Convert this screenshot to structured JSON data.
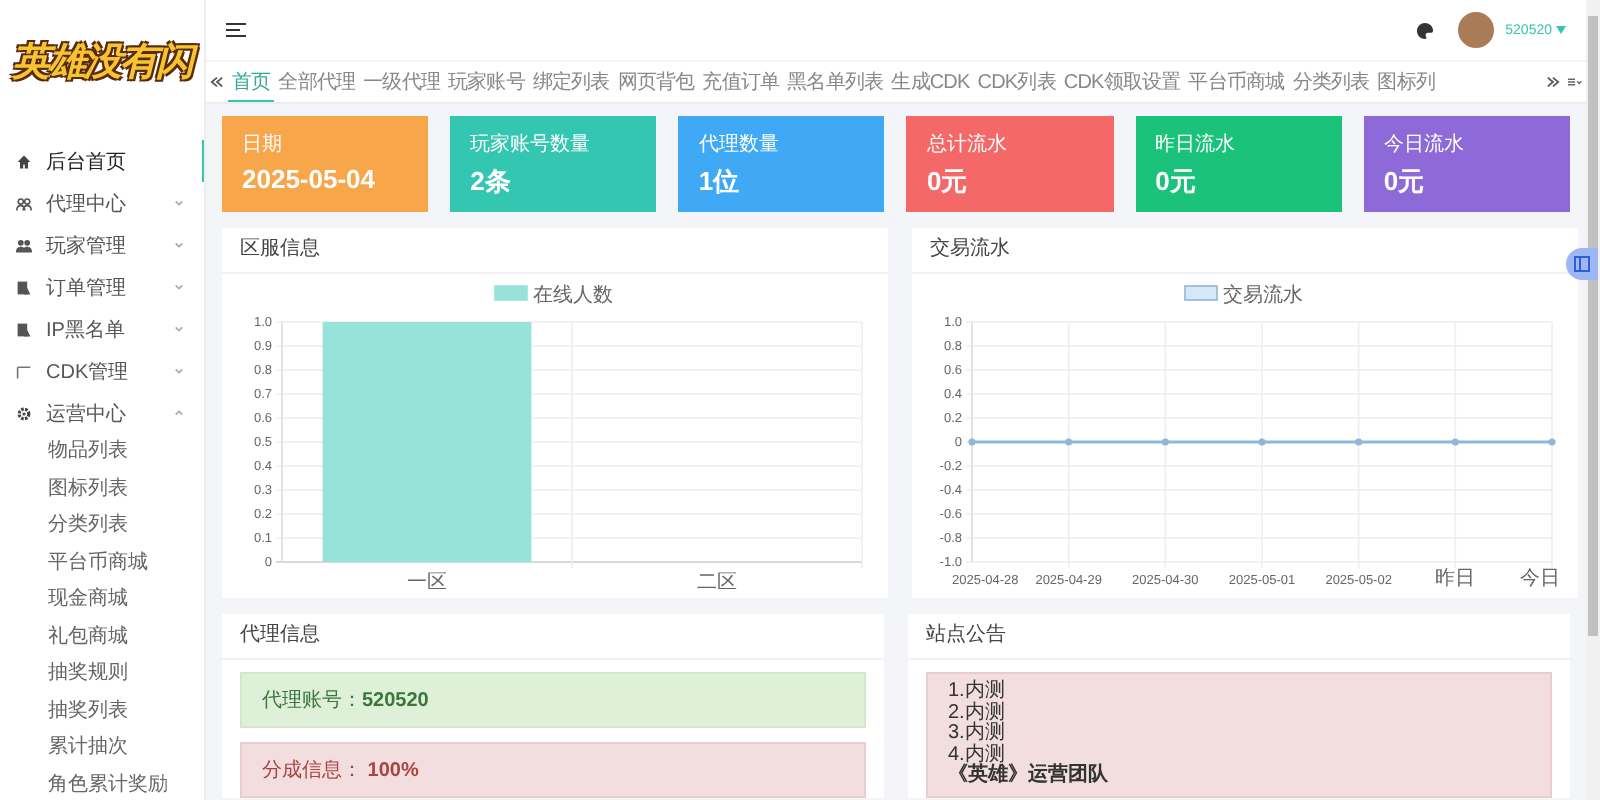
{
  "logo": {
    "text": "英雄没有闪"
  },
  "sidebar": {
    "items": [
      {
        "label": "后台首页",
        "kind": "link",
        "selected": true
      },
      {
        "label": "代理中心",
        "kind": "group",
        "selected": false,
        "expanded": false
      },
      {
        "label": "玩家管理",
        "kind": "group",
        "selected": false,
        "expanded": false
      },
      {
        "label": "订单管理",
        "kind": "group",
        "selected": false,
        "expanded": false
      },
      {
        "label": "IP黑名单",
        "kind": "group",
        "selected": false,
        "expanded": false
      },
      {
        "label": "CDK管理",
        "kind": "group",
        "selected": false,
        "expanded": false
      },
      {
        "label": "运营中心",
        "kind": "group",
        "selected": false,
        "expanded": true,
        "children": [
          {
            "label": "物品列表"
          },
          {
            "label": "图标列表"
          },
          {
            "label": "分类列表"
          },
          {
            "label": "平台币商城"
          },
          {
            "label": "现金商城"
          },
          {
            "label": "礼包商城"
          },
          {
            "label": "抽奖规则"
          },
          {
            "label": "抽奖列表"
          },
          {
            "label": "累计抽次"
          },
          {
            "label": "角色累计奖励"
          }
        ]
      }
    ]
  },
  "header": {
    "user": "520520"
  },
  "tabs": [
    {
      "label": "首页",
      "selected": true
    },
    {
      "label": "全部代理",
      "selected": false
    },
    {
      "label": "一级代理",
      "selected": false
    },
    {
      "label": "玩家账号",
      "selected": false
    },
    {
      "label": "绑定列表",
      "selected": false
    },
    {
      "label": "网页背包",
      "selected": false
    },
    {
      "label": "充值订单",
      "selected": false
    },
    {
      "label": "黑名单列表",
      "selected": false
    },
    {
      "label": "生成CDK",
      "selected": false
    },
    {
      "label": "CDK列表",
      "selected": false
    },
    {
      "label": "CDK领取设置",
      "selected": false
    },
    {
      "label": "平台币商城",
      "selected": false
    },
    {
      "label": "分类列表",
      "selected": false
    },
    {
      "label": "图标列",
      "selected": false
    }
  ],
  "stats": [
    {
      "title": "日期",
      "value": "2025-05-04",
      "color": "#f8a64a"
    },
    {
      "title": "玩家账号数量",
      "value": "2条",
      "color": "#33c6b0"
    },
    {
      "title": "代理数量",
      "value": "1位",
      "color": "#3fa9f5"
    },
    {
      "title": "总计流水",
      "value": "0元",
      "color": "#f56868"
    },
    {
      "title": "昨日流水",
      "value": "0元",
      "color": "#1bc27a"
    },
    {
      "title": "今日流水",
      "value": "0元",
      "color": "#8e6ad8"
    }
  ],
  "server_panel": {
    "title": "区服信息",
    "chart_data": {
      "type": "bar",
      "categories": [
        "一区",
        "二区"
      ],
      "series": [
        {
          "name": "在线人数",
          "color": "#97e3da",
          "values": [
            1,
            0
          ]
        }
      ],
      "grid": true,
      "ylim": [
        0,
        1
      ],
      "yticks": [
        {
          "value": 0,
          "label": "0"
        },
        {
          "value": 0.1,
          "label": "0.1"
        },
        {
          "value": 0.2,
          "label": "0.2"
        },
        {
          "value": 0.3,
          "label": "0.3"
        },
        {
          "value": 0.4,
          "label": "0.4"
        },
        {
          "value": 0.5,
          "label": "0.5"
        },
        {
          "value": 0.6,
          "label": "0.6"
        },
        {
          "value": 0.7,
          "label": "0.7"
        },
        {
          "value": 0.8,
          "label": "0.8"
        },
        {
          "value": 0.9,
          "label": "0.9"
        },
        {
          "value": 1,
          "label": "1.0"
        }
      ]
    }
  },
  "trade_panel": {
    "title": "交易流水",
    "chart_data": {
      "type": "line",
      "categories": [
        "2025-04-28",
        "2025-04-29",
        "2025-04-30",
        "2025-05-01",
        "2025-05-02",
        "昨日",
        "今日"
      ],
      "series": [
        {
          "name": "交易流水",
          "color": "#8fb8d8",
          "values": [
            0,
            0,
            0,
            0,
            0,
            0,
            0
          ],
          "marker": true
        }
      ],
      "grid": true,
      "ylim": [
        -1,
        1
      ],
      "yticks": [
        {
          "value": -1,
          "label": "-1.0"
        },
        {
          "value": -0.8,
          "label": "-0.8"
        },
        {
          "value": -0.6,
          "label": "-0.6"
        },
        {
          "value": -0.4,
          "label": "-0.4"
        },
        {
          "value": -0.2,
          "label": "-0.2"
        },
        {
          "value": 0,
          "label": "0"
        },
        {
          "value": 0.2,
          "label": "0.2"
        },
        {
          "value": 0.4,
          "label": "0.4"
        },
        {
          "value": 0.6,
          "label": "0.6"
        },
        {
          "value": 0.8,
          "label": "0.8"
        },
        {
          "value": 1,
          "label": "1.0"
        }
      ]
    }
  },
  "agent_panel": {
    "title": "代理信息",
    "notes": [
      {
        "text": "代理账号：**520520**",
        "kind": "success"
      },
      {
        "text": "分成信息： **100%**",
        "kind": "danger"
      }
    ]
  },
  "notice_panel": {
    "title": "站点公告",
    "lines": [
      {
        "text": "1.内测",
        "bold": false
      },
      {
        "text": "2.内测",
        "bold": false
      },
      {
        "text": "3.内测",
        "bold": false
      },
      {
        "text": "4.内测",
        "bold": false
      },
      {
        "text": "《英雄》运营团队",
        "bold": true
      }
    ]
  }
}
